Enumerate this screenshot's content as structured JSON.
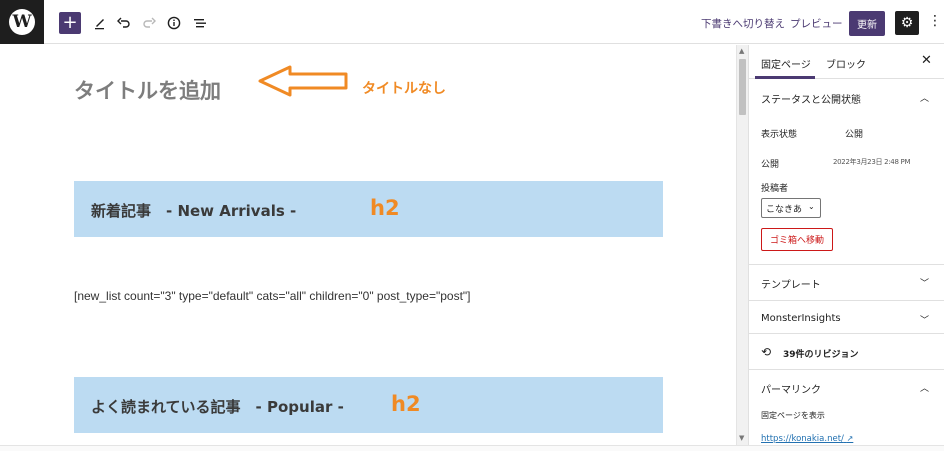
{
  "toolbar": {
    "logo_letter": "W",
    "add_symbol": "+",
    "draft_label": "下書きへ切り替え",
    "preview_label": "プレビュー",
    "update_label": "更新"
  },
  "editor": {
    "title_placeholder": "タイトルを追加",
    "title_annotation": "タイトルなし",
    "blocks": [
      {
        "heading": "新着記事　- New Arrivals -",
        "tag": "h2"
      },
      {
        "heading": "よく読まれている記事　- Popular -",
        "tag": "h2"
      }
    ],
    "shortcode": "[new_list count=\"3\" type=\"default\" cats=\"all\" children=\"0\" post_type=\"post\"]",
    "annotation_color": "#f08a24",
    "block_bg_color": "#bcdbf2"
  },
  "sidebar": {
    "tabs": [
      "固定ページ",
      "ブロック"
    ],
    "active_tab": "固定ページ",
    "status_panel": {
      "title": "ステータスと公開状態",
      "visibility_label": "表示状態",
      "visibility_value": "公開",
      "publish_label": "公開",
      "publish_value": "2022年3月23日 2:48 PM",
      "author_label": "投稿者",
      "author_value": "こなきあ",
      "trash_label": "ゴミ箱へ移動"
    },
    "template_title": "テンプレート",
    "monsterinsights_title": "MonsterInsights",
    "revisions_label": "39件のリビジョン",
    "permalink": {
      "title": "パーマリンク",
      "view_label": "固定ページを表示",
      "url": "https://konakia.net/"
    }
  },
  "accent_color": "#4b3a72",
  "icons": [
    "wordpress-logo",
    "plus-icon",
    "pencil-icon",
    "undo-icon",
    "redo-icon",
    "info-icon",
    "list-view-icon",
    "gear-icon",
    "more-icon",
    "close-icon",
    "chevron-up-icon",
    "chevron-down-icon",
    "history-icon",
    "external-link-icon",
    "arrow-annotation"
  ]
}
